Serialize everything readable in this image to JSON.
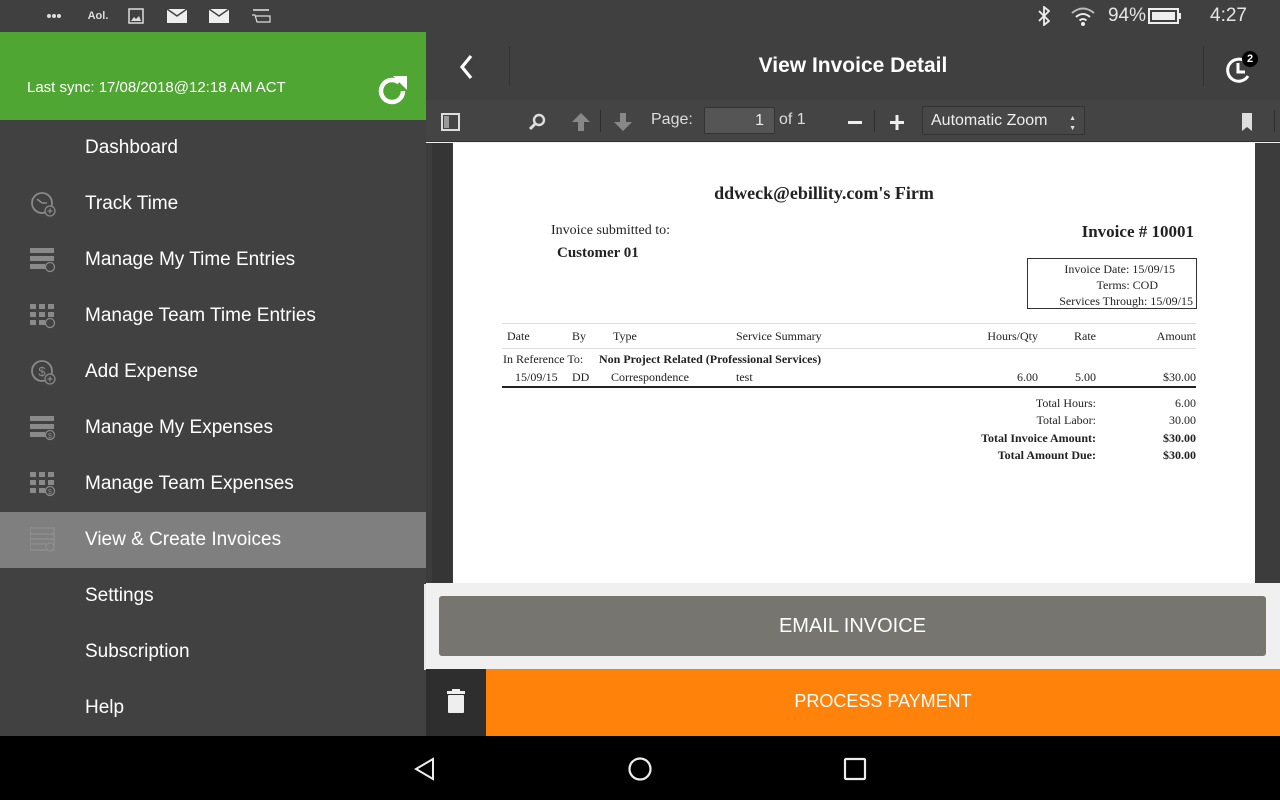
{
  "status_bar": {
    "left_icons": [
      "more-notifications-icon",
      "aol-icon",
      "gallery-icon",
      "mail-icon",
      "mail-icon",
      "amazon-icon"
    ],
    "aol_label": "Aol.",
    "right_icons": [
      "bluetooth-icon",
      "wifi-icon",
      "battery-icon"
    ],
    "battery_percent": "94%",
    "time": "4:27"
  },
  "drawer": {
    "last_sync": "Last sync:  17/08/2018@12:18 AM ACT",
    "sync_icon": "refresh-icon",
    "items": [
      {
        "label": "Dashboard",
        "icon": "none",
        "active": false
      },
      {
        "label": "Track Time",
        "icon": "clock-add-icon",
        "active": false
      },
      {
        "label": "Manage My Time Entries",
        "icon": "list-clock-icon",
        "active": false
      },
      {
        "label": "Manage Team Time Entries",
        "icon": "grid-clock-icon",
        "active": false
      },
      {
        "label": "Add Expense",
        "icon": "dollar-add-icon",
        "active": false
      },
      {
        "label": "Manage My Expenses",
        "icon": "list-dollar-icon",
        "active": false
      },
      {
        "label": "Manage Team Expenses",
        "icon": "grid-dollar-icon",
        "active": false
      },
      {
        "label": "View & Create Invoices",
        "icon": "invoice-icon",
        "active": true
      },
      {
        "label": "Settings",
        "icon": "none",
        "active": false
      },
      {
        "label": "Subscription",
        "icon": "none",
        "active": false
      },
      {
        "label": "Help",
        "icon": "none",
        "active": false
      }
    ]
  },
  "appbar": {
    "title": "View Invoice Detail",
    "back_icon": "chevron-left-icon",
    "history_icon": "sync-history-icon",
    "badge_count": "2"
  },
  "pdf_toolbar": {
    "page_label": "Page:",
    "page_value": "1",
    "page_of": "of 1",
    "zoom_value": "Automatic Zoom"
  },
  "invoice": {
    "firm": "ddweck@ebillity.com's Firm",
    "submitted_to_label": "Invoice submitted to:",
    "customer": "Customer 01",
    "invoice_number": "Invoice # 10001",
    "details": [
      {
        "label": "Invoice Date:",
        "value": "15/09/15"
      },
      {
        "label": "Terms:",
        "value": "COD"
      },
      {
        "label": "Services Through:",
        "value": "15/09/15"
      }
    ],
    "columns": [
      "Date",
      "By",
      "Type",
      "Service Summary",
      "Hours/Qty",
      "Rate",
      "Amount"
    ],
    "reference_label": "In Reference To:",
    "reference_value": "Non Project Related (Professional Services)",
    "rows": [
      {
        "date": "15/09/15",
        "by": "DD",
        "type": "Correspondence",
        "summary": "test",
        "hours": "6.00",
        "rate": "5.00",
        "amount": "$30.00"
      }
    ],
    "totals": [
      {
        "label": "Total Hours:",
        "value": "6.00",
        "bold": false
      },
      {
        "label": "Total Labor:",
        "value": "30.00",
        "bold": false
      },
      {
        "label": "Total Invoice Amount:",
        "value": "$30.00",
        "bold": true
      },
      {
        "label": "Total Amount Due:",
        "value": "$30.00",
        "bold": true
      }
    ]
  },
  "actions": {
    "email_invoice": "EMAIL INVOICE",
    "process_payment": "PROCESS PAYMENT",
    "delete_icon": "trash-icon"
  },
  "colors": {
    "sync_green": "#50a632",
    "payment_orange": "#ff820a",
    "email_gray": "#76756f",
    "drawer_bg": "#414141",
    "active_item": "#7f7f7f"
  },
  "nav_bar": [
    "back-nav-icon",
    "home-nav-icon",
    "recents-nav-icon"
  ]
}
